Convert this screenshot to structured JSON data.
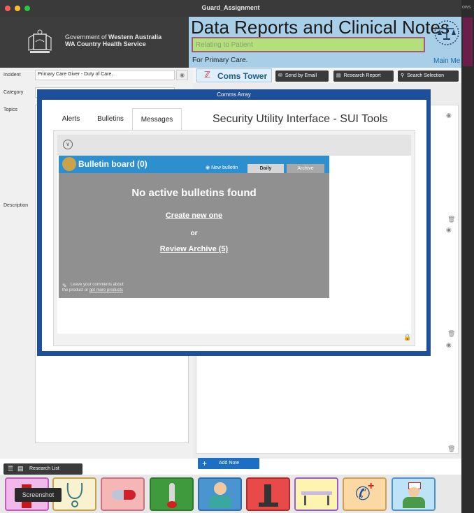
{
  "window": {
    "title": "Guard_Assignment",
    "right_strip_label": "ows"
  },
  "header": {
    "gov_line1_prefix": "Government of",
    "gov_line1_bold": "Western Australia",
    "gov_line2": "WA Country Health Service",
    "data_title": "Data Reports and Clinical Notes",
    "patient_placeholder": "Relating to Patient",
    "primary_care": "For Primary Care.",
    "main_menu": "Main Me"
  },
  "form": {
    "incident_label": "Incident",
    "incident_value": "Primary Care Giver - Duty of Care.",
    "category_label": "Category",
    "topics_label": "Topics",
    "description_label": "Description",
    "research_list": "Research List"
  },
  "toolbar": {
    "coms_tower": "Coms Tower",
    "send_email": "Send by Email",
    "research_report": "Research Report",
    "search_selection": "Search Selection",
    "add_note": "Add Note"
  },
  "modal": {
    "title": "Comms Array",
    "tabs": [
      "Alerts",
      "Bulletins",
      "Messages"
    ],
    "active_tab": "Bulletins",
    "heading": "Security Utility Interface - SUI Tools",
    "bulletin": {
      "title": "Bulletin board (0)",
      "new_bulletin": "New bulletin",
      "daily": "Daily",
      "archive": "Archive",
      "empty_message": "No active bulletins found",
      "create_link": "Create new one",
      "or": "or",
      "review_link": "Review Archive (5)",
      "comments_line1": "Leave your comments about",
      "comments_line2_prefix": "the product or",
      "comments_line2_link": "get more products"
    }
  },
  "bottom_icons": [
    "screenshot",
    "stethoscope",
    "pill",
    "thermometer",
    "doctor",
    "microscope",
    "stretcher",
    "emergency-phone",
    "nurse"
  ],
  "tooltip": "Screenshot",
  "colors": {
    "modal_border": "#1e4f9a",
    "header_bg": "#3d3d3d",
    "data_panel": "#a9cfe8",
    "bulletin_head": "#2e8fcf",
    "bulletin_body": "#909090"
  }
}
